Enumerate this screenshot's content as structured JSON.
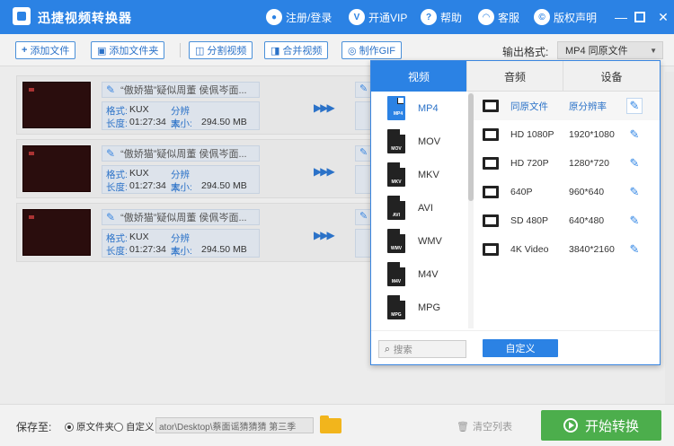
{
  "app": {
    "title": "迅捷视频转换器",
    "header_links": [
      {
        "label": "注册/登录",
        "icon": "user-icon"
      },
      {
        "label": "开通VIP",
        "icon": "vip-icon"
      },
      {
        "label": "帮助",
        "icon": "help-icon"
      },
      {
        "label": "客服",
        "icon": "headset-icon"
      },
      {
        "label": "版权声明",
        "icon": "copyright-icon"
      }
    ]
  },
  "toolbar": {
    "buttons": [
      {
        "label": "添加文件",
        "icon": "plus-icon",
        "glyph": "+"
      },
      {
        "label": "添加文件夹",
        "icon": "folder-add-icon",
        "glyph": "▣"
      },
      {
        "label": "分割视频",
        "icon": "split-icon",
        "glyph": "◫"
      },
      {
        "label": "合并视频",
        "icon": "merge-icon",
        "glyph": "◨"
      },
      {
        "label": "制作GIF",
        "icon": "gif-icon",
        "glyph": "◎"
      }
    ],
    "output_format_label": "输出格式:",
    "output_format_value": "MP4  同原文件"
  },
  "tasks": [
    {
      "name": "“傲娇猫”疑似周董 侯佩岑面...",
      "format_key": "格式:",
      "format": "KUX",
      "res_key": "分辨率:",
      "res": "",
      "dur_key": "长度:",
      "duration": "01:27:34",
      "size_key": "大小:",
      "size": "294.50 MB"
    },
    {
      "name": "“傲娇猫”疑似周董 侯佩岑面...",
      "format_key": "格式:",
      "format": "KUX",
      "res_key": "分辨率:",
      "res": "",
      "dur_key": "长度:",
      "duration": "01:27:34",
      "size_key": "大小:",
      "size": "294.50 MB"
    },
    {
      "name": "“傲娇猫”疑似周董 侯佩岑面...",
      "format_key": "格式:",
      "format": "KUX",
      "res_key": "分辨率:",
      "res": "",
      "dur_key": "长度:",
      "duration": "01:27:34",
      "size_key": "大小:",
      "size": "294.50 MB"
    }
  ],
  "format_panel": {
    "tabs": [
      "视频",
      "音频",
      "设备"
    ],
    "active_tab": 0,
    "formats": [
      "MP4",
      "MOV",
      "MKV",
      "AVI",
      "WMV",
      "M4V",
      "MPG"
    ],
    "active_format": 0,
    "presets": [
      {
        "name": "同原文件",
        "res": "原分辨率"
      },
      {
        "name": "HD 1080P",
        "res": "1920*1080"
      },
      {
        "name": "HD 720P",
        "res": "1280*720"
      },
      {
        "name": "640P",
        "res": "960*640"
      },
      {
        "name": "SD 480P",
        "res": "640*480"
      },
      {
        "name": "4K Video",
        "res": "3840*2160"
      }
    ],
    "search_placeholder": "搜索",
    "custom_label": "自定义"
  },
  "bottom": {
    "save_label": "保存至:",
    "radio_original": "原文件夹",
    "radio_custom": "自定义",
    "selected": "original",
    "path": "ator\\Desktop\\蔡面谣猜猜猜 第三季",
    "clear_label": "清空列表",
    "start_label": "开始转换"
  },
  "colors": {
    "accent": "#2b82e4",
    "start_button": "#4cae4c"
  }
}
